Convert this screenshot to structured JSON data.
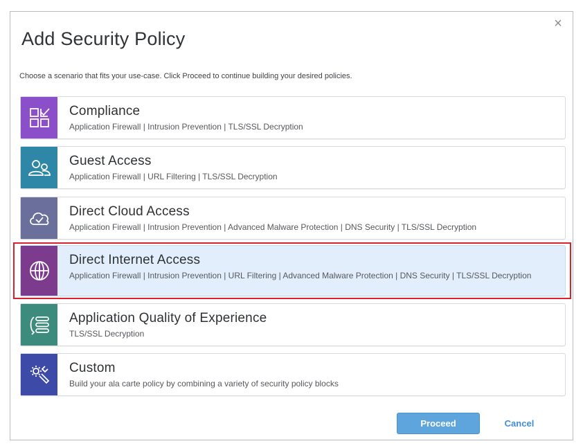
{
  "dialog": {
    "title": "Add Security Policy",
    "subtitle": "Choose a scenario that fits your use-case. Click Proceed to continue building your desired policies.",
    "close_icon": "close-icon",
    "close_glyph": "×"
  },
  "scenarios": [
    {
      "name": "Compliance",
      "features": "Application Firewall | Intrusion Prevention | TLS/SSL Decryption",
      "icon": "compliance-checklist-icon",
      "color": "#8a4fc9"
    },
    {
      "name": "Guest Access",
      "features": "Application Firewall | URL Filtering | TLS/SSL Decryption",
      "icon": "guest-users-icon",
      "color": "#2f87a8"
    },
    {
      "name": "Direct Cloud Access",
      "features": "Application Firewall | Intrusion Prevention | Advanced Malware Protection | DNS Security | TLS/SSL Decryption",
      "icon": "cloud-check-icon",
      "color": "#6b6f9c"
    },
    {
      "name": "Direct Internet Access",
      "features": "Application Firewall | Intrusion Prevention | URL Filtering | Advanced Malware Protection | DNS Security | TLS/SSL Decryption",
      "icon": "globe-icon",
      "color": "#7d3b8e",
      "selected": true
    },
    {
      "name": "Application Quality of Experience",
      "features": "TLS/SSL Decryption",
      "icon": "app-qoe-icon",
      "color": "#3c8b7c"
    },
    {
      "name": "Custom",
      "features": "Build your ala carte policy by combining a variety of security policy blocks",
      "icon": "custom-tools-icon",
      "color": "#3d4aa8"
    }
  ],
  "buttons": {
    "proceed": "Proceed",
    "cancel": "Cancel"
  },
  "colors": {
    "selected_bg": "#e2eefb",
    "highlight_border": "#d8202f",
    "primary_button": "#5ea4dd",
    "link": "#3f8ed6"
  }
}
